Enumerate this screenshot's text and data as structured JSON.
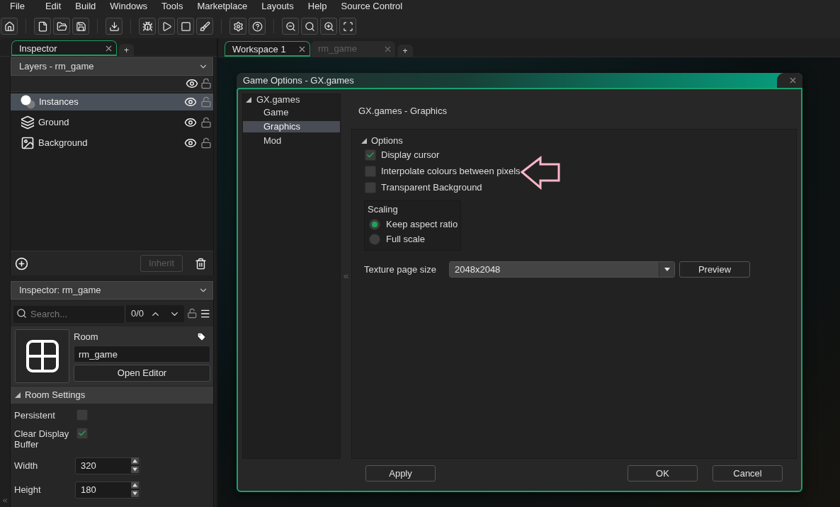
{
  "menu": [
    "File",
    "Edit",
    "Build",
    "Windows",
    "Tools",
    "Marketplace",
    "Layouts",
    "Help",
    "Source Control"
  ],
  "left_dock": {
    "tabs": [
      {
        "label": "Inspector",
        "selected": true
      }
    ],
    "new_tab": "+",
    "layers": {
      "dropdown": "Layers - rm_game",
      "items": [
        {
          "name": "Instances",
          "kind": "instances",
          "selected": true,
          "visible": true,
          "locked": false
        },
        {
          "name": "Ground",
          "kind": "tiles",
          "selected": false,
          "visible": true,
          "locked": false
        },
        {
          "name": "Background",
          "kind": "background",
          "selected": false,
          "visible": true,
          "locked": false
        }
      ],
      "inherit_button": {
        "label": "Inherit",
        "disabled": true
      }
    },
    "inspector": {
      "dropdown": "Inspector: rm_game",
      "search": {
        "placeholder": "Search...",
        "count": "0/0"
      },
      "resource": {
        "type": "Room",
        "name": "rm_game",
        "open_button": "Open Editor"
      },
      "section": {
        "title": "Room Settings",
        "expanded": true
      },
      "settings": [
        {
          "kind": "checkbox",
          "label": "Persistent",
          "checked": false
        },
        {
          "kind": "checkbox",
          "label": "Clear Display Buffer",
          "checked": true
        },
        {
          "kind": "number",
          "label": "Width",
          "value": "320"
        },
        {
          "kind": "number",
          "label": "Height",
          "value": "180"
        }
      ]
    }
  },
  "workspace": {
    "tabs": [
      {
        "label": "Workspace 1",
        "selected": true
      },
      {
        "label": "rm_game",
        "selected": false
      }
    ],
    "new_tab": "+",
    "dialog": {
      "title": "Game Options - GX.games",
      "tree": [
        {
          "label": "GX.games",
          "expanded": true,
          "selected": false,
          "children": [
            {
              "label": "Game",
              "selected": false
            },
            {
              "label": "Graphics",
              "selected": true
            },
            {
              "label": "Mod",
              "selected": false
            }
          ]
        }
      ],
      "heading": "GX.games - Graphics",
      "options": {
        "title": "Options",
        "expanded": true,
        "checkboxes": [
          {
            "label": "Display cursor",
            "checked": true
          },
          {
            "label": "Interpolate colours between pixels",
            "checked": false
          },
          {
            "label": "Transparent Background",
            "checked": false
          }
        ],
        "scaling": {
          "title": "Scaling",
          "options": [
            {
              "label": "Keep aspect ratio",
              "selected": true
            },
            {
              "label": "Full scale",
              "selected": false
            }
          ]
        },
        "texture_page_size": {
          "label": "Texture page size",
          "value": "2048x2048"
        },
        "preview_button": "Preview"
      },
      "apply_button": "Apply",
      "buttons": [
        "OK",
        "Cancel"
      ]
    }
  }
}
